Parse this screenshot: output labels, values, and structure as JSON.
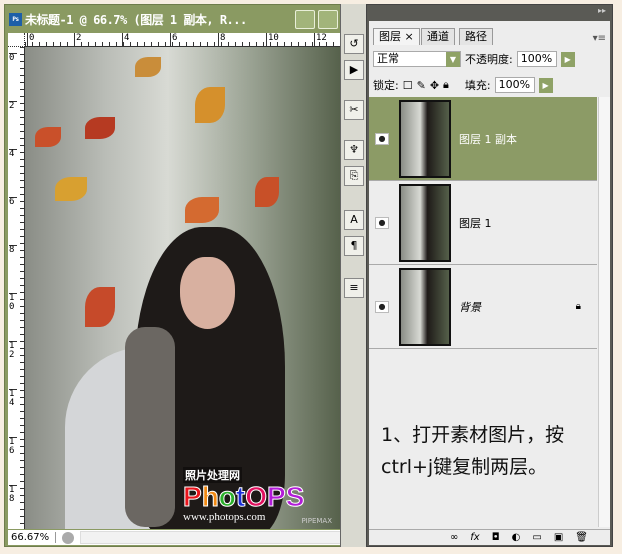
{
  "document": {
    "title": "未标题-1 @ 66.7% (图层 1 副本, R...",
    "zoom": "66.67%",
    "ruler_top": [
      "0",
      "2",
      "4",
      "6",
      "8",
      "10",
      "12"
    ],
    "ruler_left": [
      "0",
      "2",
      "4",
      "6",
      "8",
      "10",
      "12",
      "14",
      "16",
      "18"
    ],
    "watermark": {
      "cn": "照片处理网",
      "logo": "PhotOPS",
      "url": "www.photops.com",
      "signature": "PIPEMAX"
    }
  },
  "toolstrip": {
    "icons": [
      "history-icon",
      "actions-icon",
      "tool-presets-icon",
      "brushes-icon",
      "clone-source-icon",
      "character-icon",
      "paragraph-icon",
      "notes-icon"
    ]
  },
  "panel": {
    "tabs": [
      "图层",
      "通道",
      "路径"
    ],
    "blend_mode": "正常",
    "opacity_label": "不透明度:",
    "opacity": "100%",
    "lock_label": "锁定:",
    "fill_label": "填充:",
    "fill": "100%",
    "layers": [
      {
        "name": "图层 1 副本",
        "selected": true
      },
      {
        "name": "图层 1",
        "selected": false
      },
      {
        "name": "背景",
        "selected": false,
        "locked": true
      }
    ],
    "note_line1": "1、打开素材图片，按",
    "note_line2": "ctrl+j键复制两层。",
    "footer_icons": [
      "link-icon",
      "fx-icon",
      "mask-icon",
      "adjustment-icon",
      "folder-icon",
      "new-layer-icon",
      "trash-icon"
    ]
  },
  "colors": {
    "accent": "#8c9b66",
    "frame": "#8a9a62"
  }
}
